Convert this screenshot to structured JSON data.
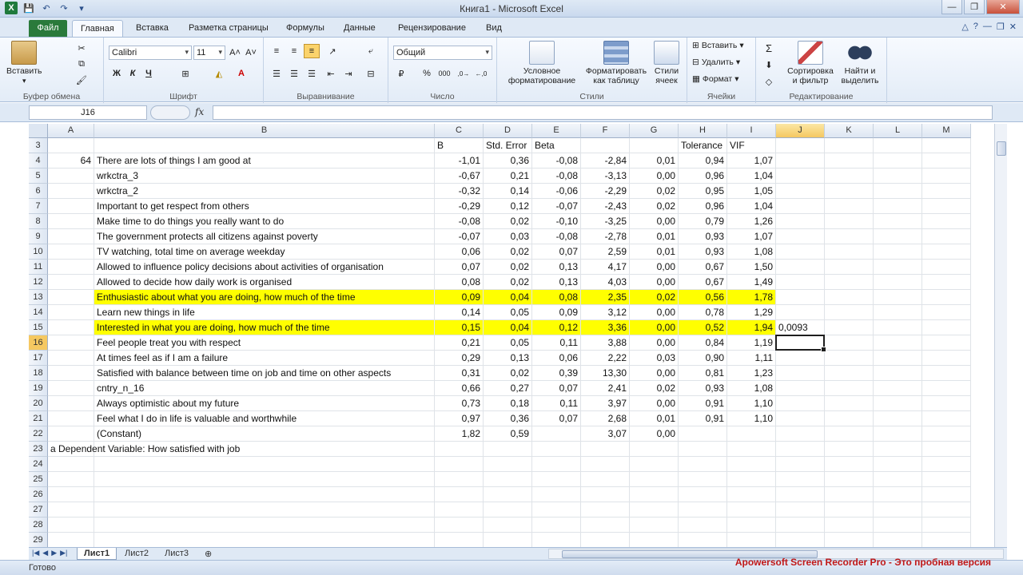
{
  "window": {
    "title": "Книга1  -  Microsoft Excel"
  },
  "qat": {
    "undo": "↶",
    "redo": "↷"
  },
  "tabs": [
    "Файл",
    "Главная",
    "Вставка",
    "Разметка страницы",
    "Формулы",
    "Данные",
    "Рецензирование",
    "Вид"
  ],
  "ribbon": {
    "clipboard": {
      "label": "Буфер обмена",
      "paste": "Вставить"
    },
    "font": {
      "label": "Шрифт",
      "name": "Calibri",
      "size": "11",
      "bold": "Ж",
      "italic": "К",
      "underline": "Ч"
    },
    "alignment": {
      "label": "Выравнивание"
    },
    "number": {
      "label": "Число",
      "format": "Общий",
      "percent": "%",
      "thousands": "000"
    },
    "styles": {
      "label": "Стили",
      "conditional": "Условное форматирование",
      "as_table": "Форматировать как таблицу",
      "cell_styles": "Стили ячеек"
    },
    "cells": {
      "label": "Ячейки",
      "insert": "Вставить",
      "delete": "Удалить",
      "format": "Формат"
    },
    "editing": {
      "label": "Редактирование",
      "sort": "Сортировка и фильтр",
      "find": "Найти и выделить",
      "sum": "Σ"
    }
  },
  "formula_bar": {
    "name_box": "J16",
    "fx": "fx",
    "value": ""
  },
  "columns": [
    "A",
    "B",
    "C",
    "D",
    "E",
    "F",
    "G",
    "H",
    "I",
    "J",
    "K",
    "L",
    "M"
  ],
  "rows": [
    {
      "n": "3",
      "a": "",
      "b": "",
      "c": "B",
      "d": "Std. Error",
      "e": "Beta",
      "f": "",
      "g": "",
      "h": "Tolerance",
      "i": "VIF",
      "j": "",
      "hl": false
    },
    {
      "n": "4",
      "a": "64",
      "b": "There are lots of things I am good at",
      "c": "-1,01",
      "d": "0,36",
      "e": "-0,08",
      "f": "-2,84",
      "g": "0,01",
      "h": "0,94",
      "i": "1,07",
      "j": "",
      "hl": false
    },
    {
      "n": "5",
      "a": "",
      "b": "wrkctra_3",
      "c": "-0,67",
      "d": "0,21",
      "e": "-0,08",
      "f": "-3,13",
      "g": "0,00",
      "h": "0,96",
      "i": "1,04",
      "j": "",
      "hl": false
    },
    {
      "n": "6",
      "a": "",
      "b": "wrkctra_2",
      "c": "-0,32",
      "d": "0,14",
      "e": "-0,06",
      "f": "-2,29",
      "g": "0,02",
      "h": "0,95",
      "i": "1,05",
      "j": "",
      "hl": false
    },
    {
      "n": "7",
      "a": "",
      "b": "Important to get respect from others",
      "c": "-0,29",
      "d": "0,12",
      "e": "-0,07",
      "f": "-2,43",
      "g": "0,02",
      "h": "0,96",
      "i": "1,04",
      "j": "",
      "hl": false
    },
    {
      "n": "8",
      "a": "",
      "b": "Make time to do things you really want to do",
      "c": "-0,08",
      "d": "0,02",
      "e": "-0,10",
      "f": "-3,25",
      "g": "0,00",
      "h": "0,79",
      "i": "1,26",
      "j": "",
      "hl": false
    },
    {
      "n": "9",
      "a": "",
      "b": "The government protects all citizens against poverty",
      "c": "-0,07",
      "d": "0,03",
      "e": "-0,08",
      "f": "-2,78",
      "g": "0,01",
      "h": "0,93",
      "i": "1,07",
      "j": "",
      "hl": false
    },
    {
      "n": "10",
      "a": "",
      "b": "TV watching, total time on average weekday",
      "c": "0,06",
      "d": "0,02",
      "e": "0,07",
      "f": "2,59",
      "g": "0,01",
      "h": "0,93",
      "i": "1,08",
      "j": "",
      "hl": false
    },
    {
      "n": "11",
      "a": "",
      "b": "Allowed to influence policy decisions about activities of organisation",
      "c": "0,07",
      "d": "0,02",
      "e": "0,13",
      "f": "4,17",
      "g": "0,00",
      "h": "0,67",
      "i": "1,50",
      "j": "",
      "hl": false
    },
    {
      "n": "12",
      "a": "",
      "b": "Allowed to decide how daily work is organised",
      "c": "0,08",
      "d": "0,02",
      "e": "0,13",
      "f": "4,03",
      "g": "0,00",
      "h": "0,67",
      "i": "1,49",
      "j": "",
      "hl": false
    },
    {
      "n": "13",
      "a": "",
      "b": "Enthusiastic about what you are doing, how much of the time",
      "c": "0,09",
      "d": "0,04",
      "e": "0,08",
      "f": "2,35",
      "g": "0,02",
      "h": "0,56",
      "i": "1,78",
      "j": "",
      "hl": true
    },
    {
      "n": "14",
      "a": "",
      "b": "Learn new things in life",
      "c": "0,14",
      "d": "0,05",
      "e": "0,09",
      "f": "3,12",
      "g": "0,00",
      "h": "0,78",
      "i": "1,29",
      "j": "",
      "hl": false
    },
    {
      "n": "15",
      "a": "",
      "b": "Interested in what you are doing, how much of the time",
      "c": "0,15",
      "d": "0,04",
      "e": "0,12",
      "f": "3,36",
      "g": "0,00",
      "h": "0,52",
      "i": "1,94",
      "j": "0,0093",
      "hl": true
    },
    {
      "n": "16",
      "a": "",
      "b": "Feel people treat you with respect",
      "c": "0,21",
      "d": "0,05",
      "e": "0,11",
      "f": "3,88",
      "g": "0,00",
      "h": "0,84",
      "i": "1,19",
      "j": "",
      "hl": false
    },
    {
      "n": "17",
      "a": "",
      "b": "At times feel as if I am a failure",
      "c": "0,29",
      "d": "0,13",
      "e": "0,06",
      "f": "2,22",
      "g": "0,03",
      "h": "0,90",
      "i": "1,11",
      "j": "",
      "hl": false
    },
    {
      "n": "18",
      "a": "",
      "b": "Satisfied with balance between time on job and time on other aspects",
      "c": "0,31",
      "d": "0,02",
      "e": "0,39",
      "f": "13,30",
      "g": "0,00",
      "h": "0,81",
      "i": "1,23",
      "j": "",
      "hl": false
    },
    {
      "n": "19",
      "a": "",
      "b": "cntry_n_16",
      "c": "0,66",
      "d": "0,27",
      "e": "0,07",
      "f": "2,41",
      "g": "0,02",
      "h": "0,93",
      "i": "1,08",
      "j": "",
      "hl": false
    },
    {
      "n": "20",
      "a": "",
      "b": "Always optimistic about my future",
      "c": "0,73",
      "d": "0,18",
      "e": "0,11",
      "f": "3,97",
      "g": "0,00",
      "h": "0,91",
      "i": "1,10",
      "j": "",
      "hl": false
    },
    {
      "n": "21",
      "a": "",
      "b": "Feel what I do in life is valuable and worthwhile",
      "c": "0,97",
      "d": "0,36",
      "e": "0,07",
      "f": "2,68",
      "g": "0,01",
      "h": "0,91",
      "i": "1,10",
      "j": "",
      "hl": false
    },
    {
      "n": "22",
      "a": "",
      "b": "(Constant)",
      "c": "1,82",
      "d": "0,59",
      "e": "",
      "f": "3,07",
      "g": "0,00",
      "h": "",
      "i": "",
      "j": "",
      "hl": false
    },
    {
      "n": "23",
      "a": "a Dependent Variable: How satisfied with job",
      "b": "",
      "c": "",
      "d": "",
      "e": "",
      "f": "",
      "g": "",
      "h": "",
      "i": "",
      "j": "",
      "hl": false
    },
    {
      "n": "24",
      "a": "",
      "b": "",
      "c": "",
      "d": "",
      "e": "",
      "f": "",
      "g": "",
      "h": "",
      "i": "",
      "j": "",
      "hl": false
    },
    {
      "n": "25",
      "a": "",
      "b": "",
      "c": "",
      "d": "",
      "e": "",
      "f": "",
      "g": "",
      "h": "",
      "i": "",
      "j": "",
      "hl": false
    },
    {
      "n": "26",
      "a": "",
      "b": "",
      "c": "",
      "d": "",
      "e": "",
      "f": "",
      "g": "",
      "h": "",
      "i": "",
      "j": "",
      "hl": false
    },
    {
      "n": "27",
      "a": "",
      "b": "",
      "c": "",
      "d": "",
      "e": "",
      "f": "",
      "g": "",
      "h": "",
      "i": "",
      "j": "",
      "hl": false
    },
    {
      "n": "28",
      "a": "",
      "b": "",
      "c": "",
      "d": "",
      "e": "",
      "f": "",
      "g": "",
      "h": "",
      "i": "",
      "j": "",
      "hl": false
    },
    {
      "n": "29",
      "a": "",
      "b": "",
      "c": "",
      "d": "",
      "e": "",
      "f": "",
      "g": "",
      "h": "",
      "i": "",
      "j": "",
      "hl": false
    }
  ],
  "active_cell": {
    "col": "J",
    "row": "16"
  },
  "sheets": [
    "Лист1",
    "Лист2",
    "Лист3"
  ],
  "status": {
    "ready": "Готово"
  },
  "watermark": "Apowersoft Screen Recorder Pro - Это пробная версия",
  "colors": {
    "highlight": "#ffff00",
    "file_tab": "#2a7a3b",
    "selection_header": "#f5c861"
  }
}
